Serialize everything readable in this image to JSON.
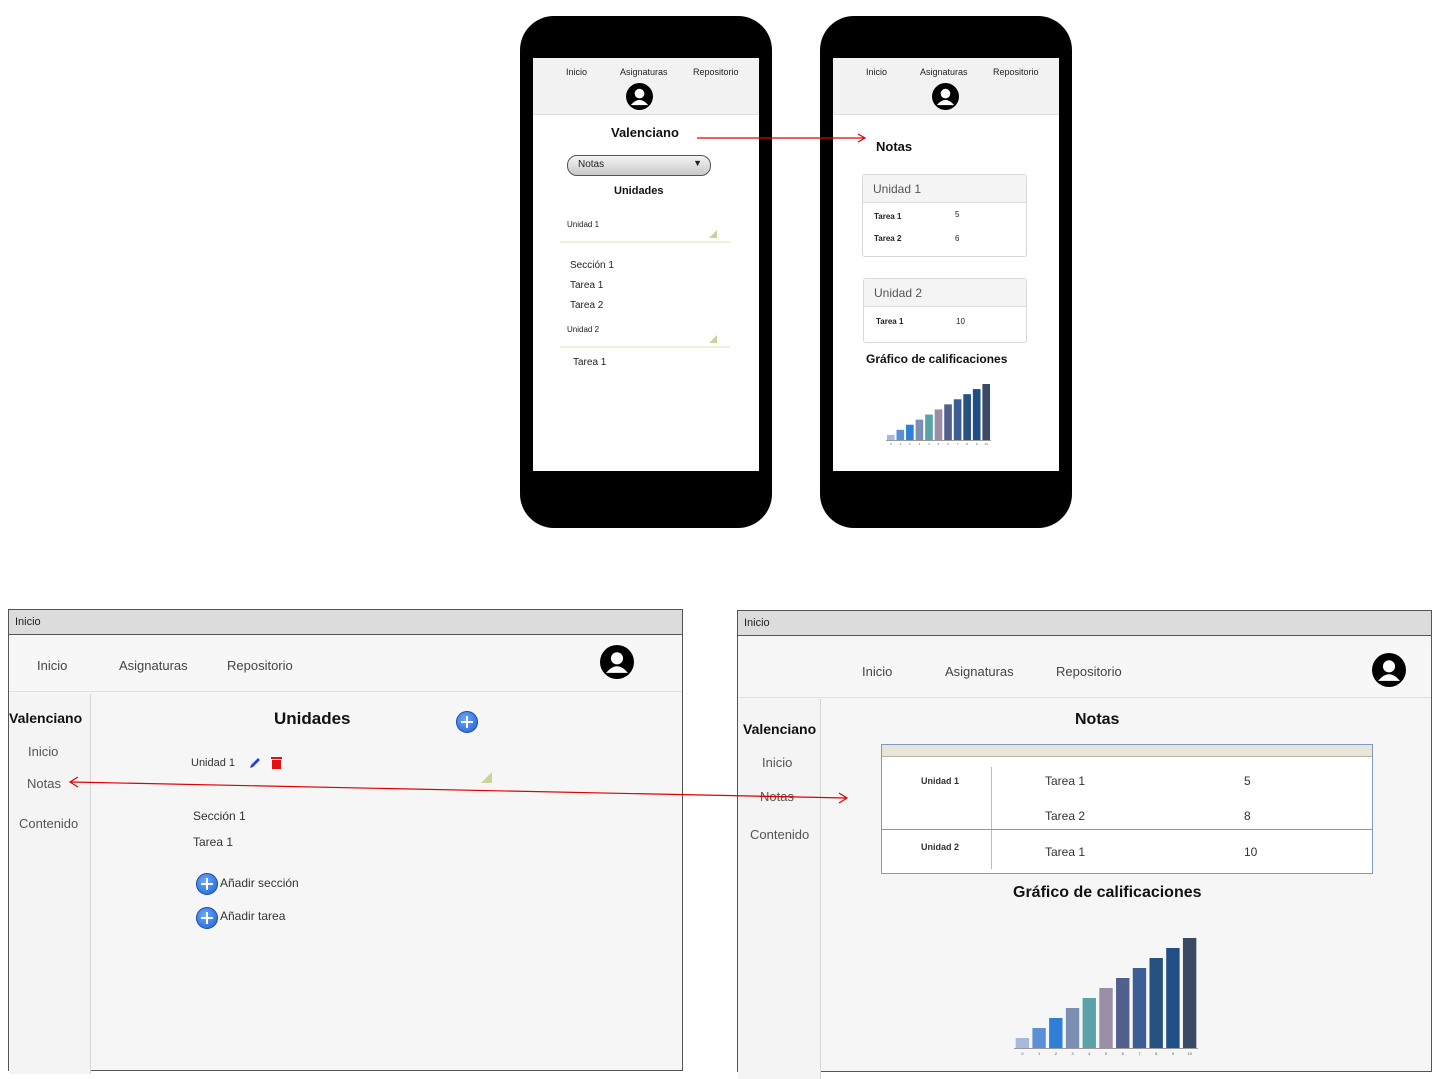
{
  "nav": {
    "inicio": "Inicio",
    "asignaturas": "Asignaturas",
    "repositorio": "Repositorio"
  },
  "phone1": {
    "title": "Valenciano",
    "dropdown_value": "Notas",
    "section_title": "Unidades",
    "unit1": "Unidad 1",
    "items1": [
      "Sección 1",
      "Tarea 1",
      "Tarea 2"
    ],
    "unit2": "Unidad 2",
    "items2": [
      "Tarea 1"
    ]
  },
  "phone2": {
    "title": "Notas",
    "card1": {
      "header": "Unidad 1",
      "rows": [
        {
          "task": "Tarea 1",
          "grade": "5"
        },
        {
          "task": "Tarea 2",
          "grade": "6"
        }
      ]
    },
    "card2": {
      "header": "Unidad 2",
      "rows": [
        {
          "task": "Tarea 1",
          "grade": "10"
        }
      ]
    },
    "chart_title": "Gráfico de calificaciones"
  },
  "desk1": {
    "window_title": "Inicio",
    "sidebar": {
      "title": "Valenciano",
      "items": [
        "Inicio",
        "Notas",
        "Contenido"
      ]
    },
    "main_title": "Unidades",
    "unit1": "Unidad 1",
    "items": [
      "Sección 1",
      "Tarea 1"
    ],
    "add_section": "Añadir sección",
    "add_task": "Añadir tarea"
  },
  "desk2": {
    "window_title": "Inicio",
    "sidebar": {
      "title": "Valenciano",
      "items": [
        "Inicio",
        "Notas",
        "Contenido"
      ]
    },
    "main_title": "Notas",
    "table": {
      "unit1": "Unidad 1",
      "rows1": [
        {
          "task": "Tarea 1",
          "grade": "5"
        },
        {
          "task": "Tarea 2",
          "grade": "8"
        }
      ],
      "unit2": "Unidad 2",
      "rows2": [
        {
          "task": "Tarea 1",
          "grade": "10"
        }
      ]
    },
    "chart_title": "Gráfico de calificaciones"
  },
  "colors": {
    "arrow": "#e00000",
    "edit_icon": "#2244dd",
    "delete_icon": "#e01010",
    "plus_icon": "#2a6fdb"
  },
  "chart_data": {
    "type": "bar",
    "categories": [
      "0",
      "1",
      "2",
      "3",
      "4",
      "5",
      "6",
      "7",
      "8",
      "9",
      "10"
    ],
    "values": [
      1,
      2,
      3,
      4,
      5,
      6,
      7,
      8,
      9,
      10,
      11
    ],
    "colors": [
      "#a9b8dd",
      "#5b8fd6",
      "#2f7fd9",
      "#7c8fb3",
      "#5aa2a8",
      "#9a8fa6",
      "#52608e",
      "#3d5d95",
      "#27517f",
      "#1f4f86",
      "#3b4a63"
    ],
    "title": "Gráfico de calificaciones",
    "xlabel": "",
    "ylabel": ""
  }
}
